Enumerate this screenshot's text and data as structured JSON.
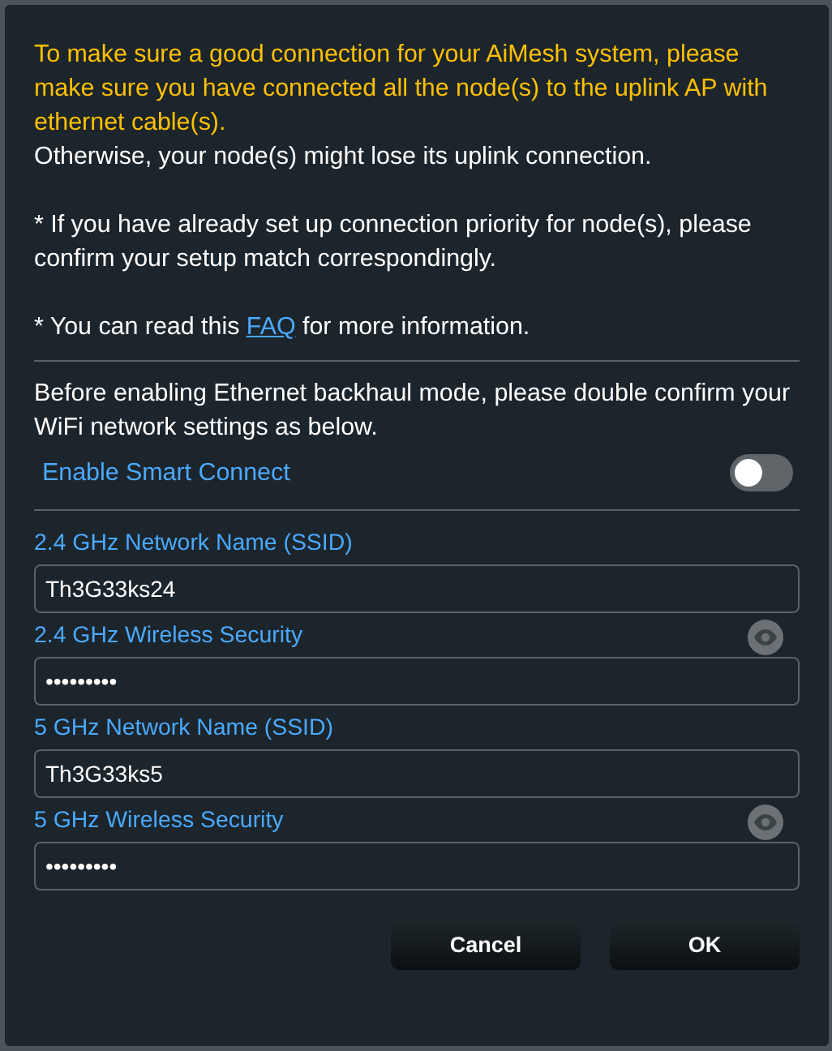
{
  "notice": {
    "warning": "To make sure a good connection for your AiMesh system, please make sure you have connected all the node(s) to the uplink AP with ethernet cable(s).",
    "consequence": "Otherwise, your node(s) might lose its uplink connection.",
    "priority_note": "* If you have already set up connection priority for node(s), please confirm your setup match correspondingly.",
    "faq_note": {
      "before": "* You can read this",
      "link": "FAQ",
      "after": "for more information."
    }
  },
  "intro": "Before enabling Ethernet backhaul mode, please double confirm your WiFi network settings as below.",
  "smart_connect": {
    "label": "Enable Smart Connect",
    "on": false
  },
  "fields": [
    {
      "kind": "text",
      "label": "2.4 GHz Network Name (SSID)",
      "value": "Th3G33ks24"
    },
    {
      "kind": "password",
      "label": "2.4 GHz Wireless Security",
      "value": "•••••••••"
    },
    {
      "kind": "text",
      "label": "5 GHz Network Name (SSID)",
      "value": "Th3G33ks5"
    },
    {
      "kind": "password",
      "label": "5 GHz Wireless Security",
      "value": "•••••••••"
    }
  ],
  "buttons": [
    "Cancel",
    "OK"
  ]
}
